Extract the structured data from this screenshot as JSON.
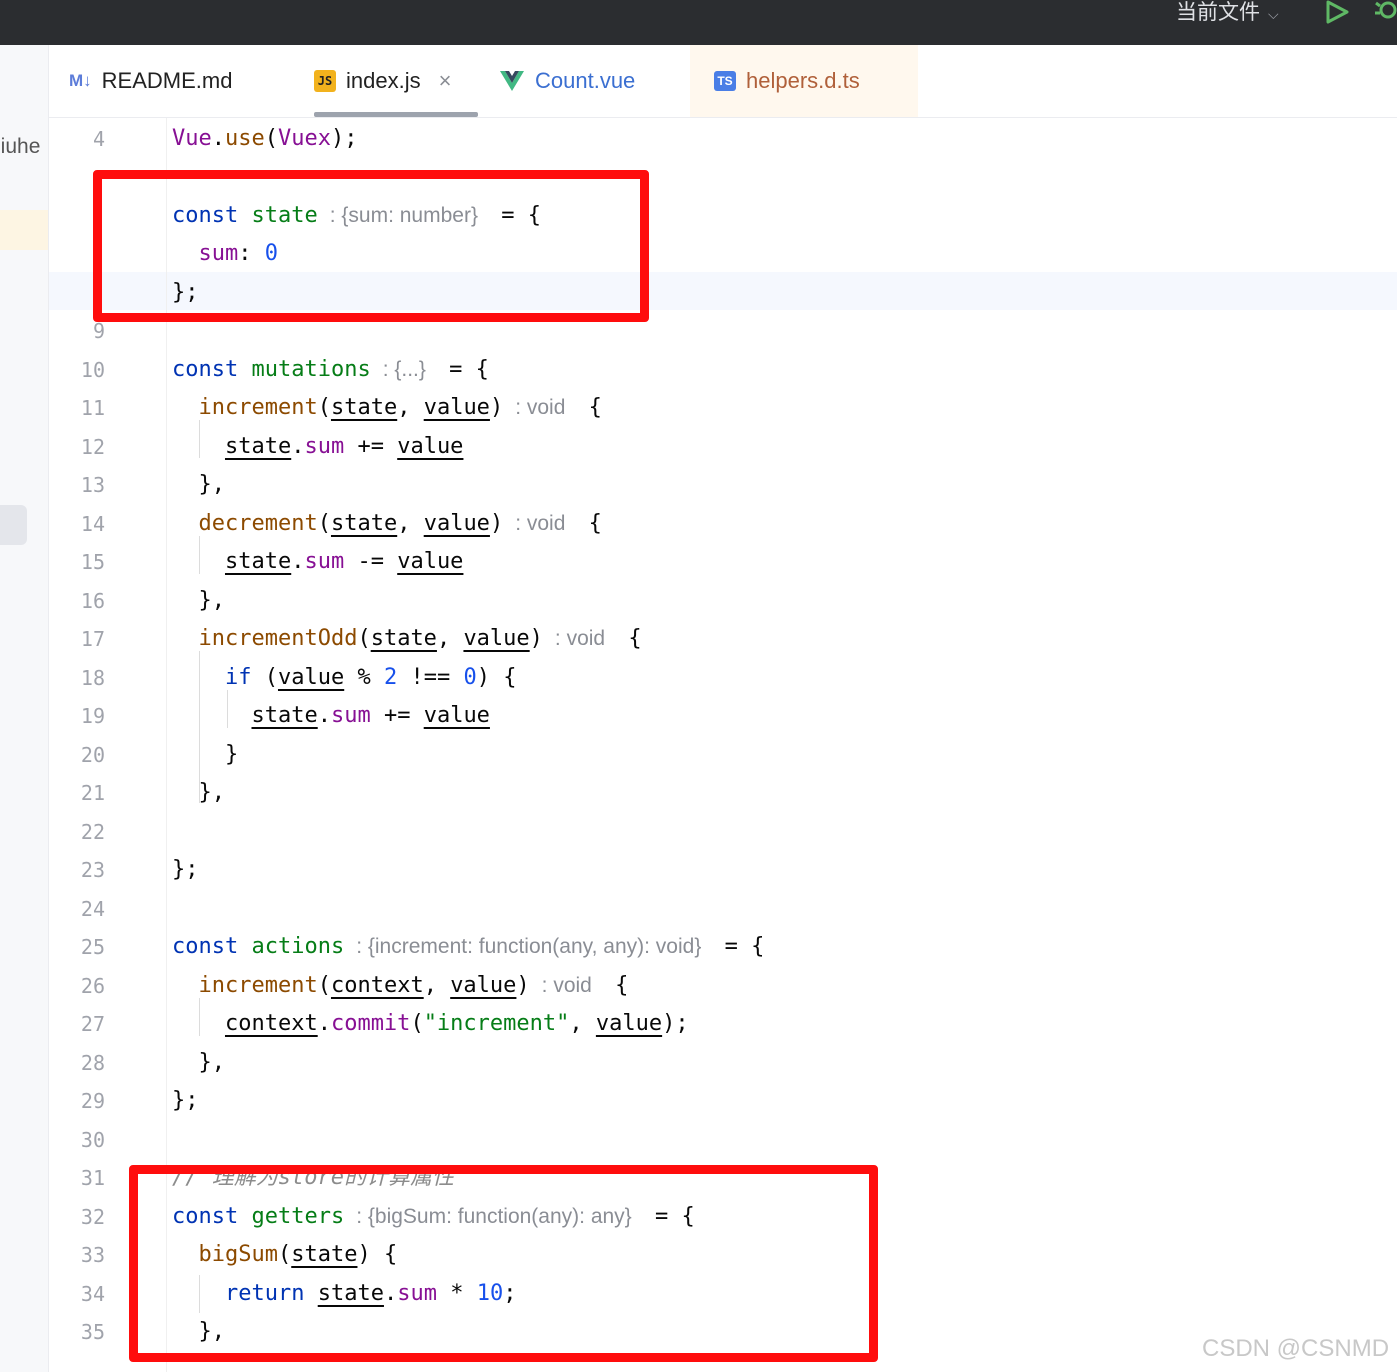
{
  "titlebar": {
    "run_config": "当前文件",
    "run_icon": "run-triangle-icon",
    "debug_icon": "debug-bug-icon"
  },
  "sidebar": {
    "project_label": "jiuhe"
  },
  "tabs": [
    {
      "label": "README.md",
      "icon": "M↓"
    },
    {
      "label": "index.js",
      "icon": "JS",
      "close": "×"
    },
    {
      "label": "Count.vue",
      "icon": "vue-icon"
    },
    {
      "label": "helpers.d.ts",
      "icon": "TS"
    }
  ],
  "code": {
    "line_numbers": [
      "4",
      "9",
      "10",
      "11",
      "12",
      "13",
      "14",
      "15",
      "16",
      "17",
      "18",
      "19",
      "20",
      "21",
      "22",
      "23",
      "24",
      "25",
      "26",
      "27",
      "28",
      "29",
      "30",
      "31",
      "32",
      "33",
      "34",
      "35"
    ],
    "hints": {
      "state": ": {sum: number}",
      "mutations": ": {...}",
      "increment": ": void",
      "decrement": ": void",
      "incrementOdd": ": void",
      "actions": ": {increment: function(any, any): void}",
      "action_increment": ": void",
      "getters": ": {bigSum: function(any): any}"
    },
    "comment": "// 理解为store的计算属性",
    "commit_string": "\"increment\""
  },
  "colors": {
    "highlight_box": "#ff0d0d",
    "keyword": "#0033b3",
    "function": "#8c4a00"
  },
  "watermark": "CSDN @CSNMD"
}
